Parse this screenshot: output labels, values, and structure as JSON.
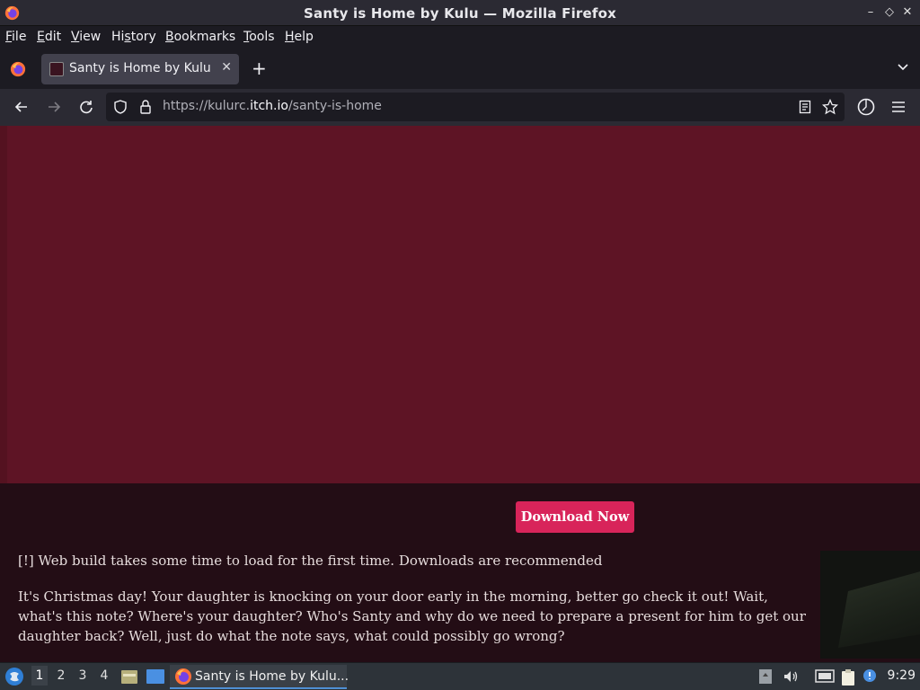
{
  "window": {
    "title": "Santy is Home by Kulu — Mozilla Firefox"
  },
  "menubar": {
    "items": [
      {
        "label": "File",
        "key": "F"
      },
      {
        "label": "Edit",
        "key": "E"
      },
      {
        "label": "View",
        "key": "V"
      },
      {
        "label": "History",
        "key": "s"
      },
      {
        "label": "Bookmarks",
        "key": "B"
      },
      {
        "label": "Tools",
        "key": "T"
      },
      {
        "label": "Help",
        "key": "H"
      }
    ]
  },
  "tabs": [
    {
      "title": "Santy is Home by Kulu",
      "active": true
    }
  ],
  "navbar": {
    "url_prefix": "https://kulurc.",
    "url_host": "itch.io",
    "url_path": "/santy-is-home"
  },
  "page": {
    "download_label": "Download Now",
    "note": "[!] Web build takes some time to load for the first time. Downloads are recommended",
    "description": "It's Christmas day! Your daughter is knocking on your door early in the morning, better go check it out! Wait, what's this note? Where's your daughter? Who's Santy and why do we need to prepare a present for him to get our daughter back? Well, just do what the note says, what could possibly go wrong?",
    "colors": {
      "game_frame": "#5e1425",
      "page_bg": "#230d15",
      "button": "#d8245a"
    }
  },
  "taskbar": {
    "workspaces": [
      "1",
      "2",
      "3",
      "4"
    ],
    "active_workspace": "1",
    "task_label": "Santy is Home by Kulu...",
    "clock": "9:29"
  }
}
